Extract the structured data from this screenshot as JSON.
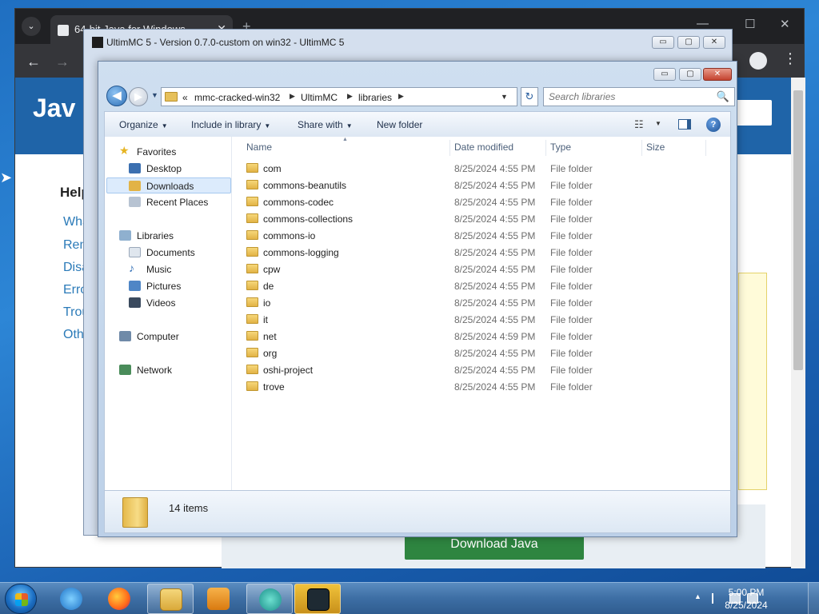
{
  "chrome": {
    "tab_title": "64-bit Java for Windows",
    "tab_close": "✕",
    "new_tab": "+",
    "win_min": "—",
    "win_max": "☐",
    "win_close": "✕",
    "back": "←",
    "forward": "→",
    "menu": "⋮"
  },
  "java_page": {
    "logo": "Jav",
    "help_title": "Help",
    "links": [
      "What",
      "Rem",
      "Disa",
      "Erro",
      "Trou",
      "Othe"
    ],
    "download_button": "Download Java"
  },
  "ultimmc": {
    "title": "UltimMC 5 - Version 0.7.0-custom on win32 - UltimMC 5",
    "min": "▭",
    "max": "▢",
    "close": "✕"
  },
  "explorer": {
    "controls": {
      "min": "▭",
      "max": "▢",
      "close": "✕"
    },
    "nav": {
      "back": "◀",
      "forward": "▶",
      "recent": "▼",
      "refresh": "↻",
      "address_dropdown": "▼"
    },
    "breadcrumb": {
      "overflow": "«",
      "items": [
        "mmc-cracked-win32",
        "UltimMC",
        "libraries"
      ],
      "sep": "▶"
    },
    "search_placeholder": "Search libraries",
    "search_icon": "🔍",
    "commands": {
      "organize": "Organize",
      "include": "Include in library",
      "share": "Share with",
      "new_folder": "New folder",
      "dd": "▼",
      "views_icon": "☷",
      "help": "?"
    },
    "nav_pane": {
      "favorites": "Favorites",
      "desktop": "Desktop",
      "downloads": "Downloads",
      "recent_places": "Recent Places",
      "libraries": "Libraries",
      "documents": "Documents",
      "music": "Music",
      "pictures": "Pictures",
      "videos": "Videos",
      "computer": "Computer",
      "network": "Network"
    },
    "columns": {
      "name": "Name",
      "date": "Date modified",
      "type": "Type",
      "size": "Size",
      "sort_arrow": "▲"
    },
    "files": [
      {
        "name": "com",
        "date": "8/25/2024 4:55 PM",
        "type": "File folder"
      },
      {
        "name": "commons-beanutils",
        "date": "8/25/2024 4:55 PM",
        "type": "File folder"
      },
      {
        "name": "commons-codec",
        "date": "8/25/2024 4:55 PM",
        "type": "File folder"
      },
      {
        "name": "commons-collections",
        "date": "8/25/2024 4:55 PM",
        "type": "File folder"
      },
      {
        "name": "commons-io",
        "date": "8/25/2024 4:55 PM",
        "type": "File folder"
      },
      {
        "name": "commons-logging",
        "date": "8/25/2024 4:55 PM",
        "type": "File folder"
      },
      {
        "name": "cpw",
        "date": "8/25/2024 4:55 PM",
        "type": "File folder"
      },
      {
        "name": "de",
        "date": "8/25/2024 4:55 PM",
        "type": "File folder"
      },
      {
        "name": "io",
        "date": "8/25/2024 4:55 PM",
        "type": "File folder"
      },
      {
        "name": "it",
        "date": "8/25/2024 4:55 PM",
        "type": "File folder"
      },
      {
        "name": "net",
        "date": "8/25/2024 4:59 PM",
        "type": "File folder"
      },
      {
        "name": "org",
        "date": "8/25/2024 4:55 PM",
        "type": "File folder"
      },
      {
        "name": "oshi-project",
        "date": "8/25/2024 4:55 PM",
        "type": "File folder"
      },
      {
        "name": "trove",
        "date": "8/25/2024 4:55 PM",
        "type": "File folder"
      }
    ],
    "item_count": "14 items"
  },
  "taskbar": {
    "tray_up": "▲",
    "time": "5:00 PM",
    "date": "8/25/2024"
  },
  "colors": {
    "explorer_selection": "#dcebfc",
    "java_blue": "#1f64a8",
    "download_green": "#2e8540"
  }
}
